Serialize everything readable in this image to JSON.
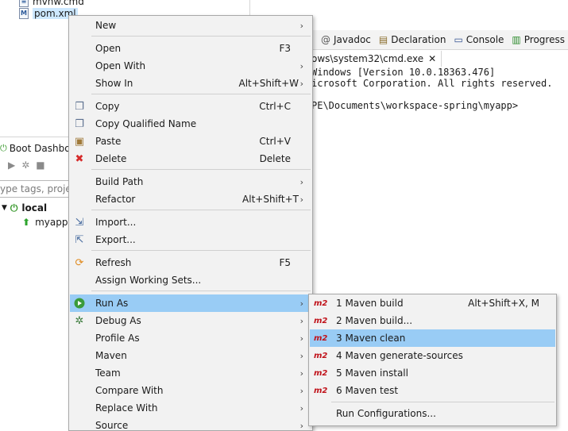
{
  "explorer": {
    "items": [
      {
        "label": "mvnw.cmd",
        "icon": "file-icon"
      },
      {
        "label": "pom.xml",
        "icon": "maven-pom-icon"
      }
    ]
  },
  "boot_dashboard": {
    "title": "Boot Dashboa",
    "filter_placeholder": "ype tags, projec",
    "local_label": "local",
    "app_label": "myapp"
  },
  "console": {
    "tabs": [
      {
        "label": "Javadoc",
        "icon": "@"
      },
      {
        "label": "Declaration",
        "icon": "declaration-icon"
      },
      {
        "label": "Console",
        "icon": "console-icon"
      },
      {
        "label": "Progress",
        "icon": "progress-icon"
      }
    ],
    "title_tab": "ows\\system32\\cmd.exe",
    "lines": [
      "Windows [Version 10.0.18363.476]",
      "icrosoft Corporation. All rights reserved.",
      "",
      "PE\\Documents\\workspace-spring\\myapp>"
    ]
  },
  "context_menu": {
    "items": [
      {
        "label": "New",
        "shortcut": "",
        "submenu": true,
        "icon": ""
      },
      {
        "label": "Open",
        "shortcut": "F3",
        "submenu": false,
        "icon": ""
      },
      {
        "label": "Open With",
        "shortcut": "",
        "submenu": true,
        "icon": ""
      },
      {
        "label": "Show In",
        "shortcut": "Alt+Shift+W",
        "submenu": true,
        "icon": ""
      },
      {
        "label": "Copy",
        "shortcut": "Ctrl+C",
        "submenu": false,
        "icon": "copy-icon"
      },
      {
        "label": "Copy Qualified Name",
        "shortcut": "",
        "submenu": false,
        "icon": "copy-qualified-icon"
      },
      {
        "label": "Paste",
        "shortcut": "Ctrl+V",
        "submenu": false,
        "icon": "paste-icon"
      },
      {
        "label": "Delete",
        "shortcut": "Delete",
        "submenu": false,
        "icon": "delete-icon"
      },
      {
        "label": "Build Path",
        "shortcut": "",
        "submenu": true,
        "icon": ""
      },
      {
        "label": "Refactor",
        "shortcut": "Alt+Shift+T",
        "submenu": true,
        "icon": ""
      },
      {
        "label": "Import...",
        "shortcut": "",
        "submenu": false,
        "icon": "import-icon"
      },
      {
        "label": "Export...",
        "shortcut": "",
        "submenu": false,
        "icon": "export-icon"
      },
      {
        "label": "Refresh",
        "shortcut": "F5",
        "submenu": false,
        "icon": "refresh-icon"
      },
      {
        "label": "Assign Working Sets...",
        "shortcut": "",
        "submenu": false,
        "icon": ""
      },
      {
        "label": "Run As",
        "shortcut": "",
        "submenu": true,
        "icon": "run-icon",
        "highlighted": true
      },
      {
        "label": "Debug As",
        "shortcut": "",
        "submenu": true,
        "icon": "debug-icon"
      },
      {
        "label": "Profile As",
        "shortcut": "",
        "submenu": true,
        "icon": ""
      },
      {
        "label": "Maven",
        "shortcut": "",
        "submenu": true,
        "icon": ""
      },
      {
        "label": "Team",
        "shortcut": "",
        "submenu": true,
        "icon": ""
      },
      {
        "label": "Compare With",
        "shortcut": "",
        "submenu": true,
        "icon": ""
      },
      {
        "label": "Replace With",
        "shortcut": "",
        "submenu": true,
        "icon": ""
      },
      {
        "label": "Source",
        "shortcut": "",
        "submenu": true,
        "icon": ""
      }
    ]
  },
  "run_as_submenu": {
    "badge": "m2",
    "items": [
      {
        "label": "1 Maven build",
        "shortcut": "Alt+Shift+X, M"
      },
      {
        "label": "2 Maven build...",
        "shortcut": ""
      },
      {
        "label": "3 Maven clean",
        "shortcut": "",
        "highlighted": true
      },
      {
        "label": "4 Maven generate-sources",
        "shortcut": ""
      },
      {
        "label": "5 Maven install",
        "shortcut": ""
      },
      {
        "label": "6 Maven test",
        "shortcut": ""
      }
    ],
    "run_configurations": "Run Configurations..."
  },
  "colors": {
    "highlight": "#99ccf5",
    "m2_badge": "#c0121a",
    "menu_bg": "#f2f2f2"
  }
}
